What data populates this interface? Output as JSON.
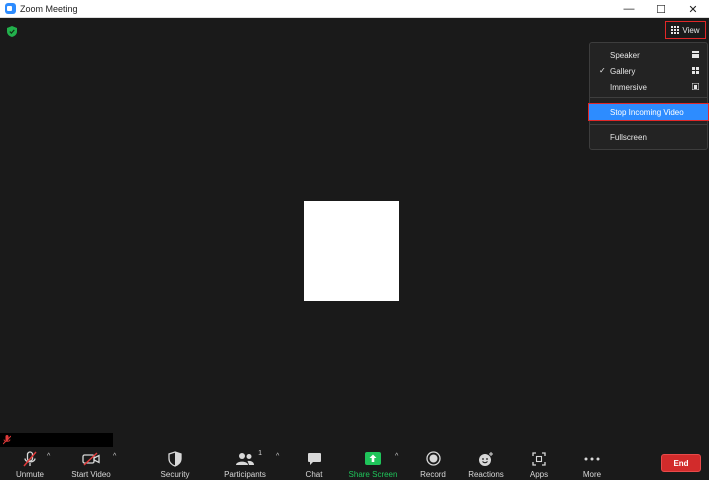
{
  "window": {
    "title": "Zoom Meeting",
    "controls": {
      "minimize": "—",
      "maximize": "☐",
      "close": "✕"
    }
  },
  "view_button": {
    "label": "View",
    "icon": "grid-icon"
  },
  "view_menu": {
    "items": [
      {
        "label": "Speaker",
        "checked": false,
        "icon": "speaker-layout-icon"
      },
      {
        "label": "Gallery",
        "checked": true,
        "icon": "gallery-layout-icon"
      },
      {
        "label": "Immersive",
        "checked": false,
        "icon": "immersive-layout-icon"
      },
      {
        "label": "Stop Incoming Video",
        "highlighted": true
      },
      {
        "label": "Fullscreen"
      }
    ],
    "check_glyph": "✓"
  },
  "toolbar": {
    "unmute": "Unmute",
    "start_video": "Start Video",
    "security": "Security",
    "participants": "Participants",
    "participants_count": "1",
    "chat": "Chat",
    "share_screen": "Share Screen",
    "record": "Record",
    "reactions": "Reactions",
    "apps": "Apps",
    "more": "More",
    "end": "End",
    "caret": "^"
  },
  "colors": {
    "accent_blue": "#2d8cff",
    "share_green": "#1fc45a",
    "end_red": "#d22b2b",
    "highlight_border": "#e02828"
  }
}
